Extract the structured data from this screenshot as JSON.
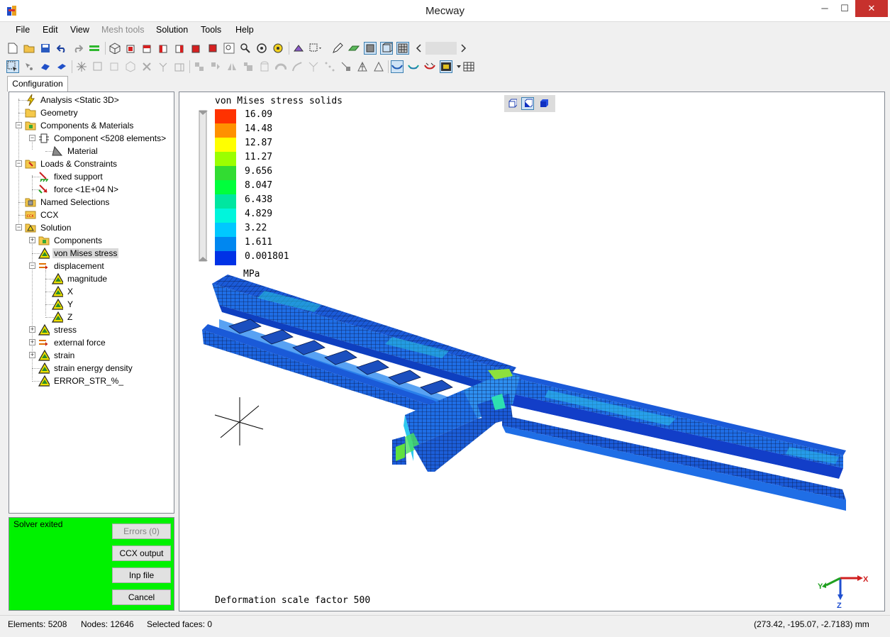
{
  "window": {
    "title": "Mecway",
    "minimize": "─",
    "maximize": "☐",
    "close": "✕"
  },
  "menu": [
    {
      "label": "File",
      "enabled": true
    },
    {
      "label": "Edit",
      "enabled": true
    },
    {
      "label": "View",
      "enabled": true
    },
    {
      "label": "Mesh tools",
      "enabled": false
    },
    {
      "label": "Solution",
      "enabled": true
    },
    {
      "label": "Tools",
      "enabled": true
    },
    {
      "label": "Help",
      "enabled": true
    }
  ],
  "tabs": {
    "configuration": "Configuration"
  },
  "tree": {
    "analysis": "Analysis <Static 3D>",
    "geometry": "Geometry",
    "components_materials": "Components & Materials",
    "component": "Component <5208 elements>",
    "material": "Material",
    "loads_constraints": "Loads & Constraints",
    "fixed_support": "fixed support",
    "force": "force <1E+04 N>",
    "named_selections": "Named Selections",
    "ccx": "CCX",
    "solution": "Solution",
    "sol_components": "Components",
    "von_mises": "von Mises stress",
    "displacement": "displacement",
    "magnitude": "magnitude",
    "x": "X",
    "y": "Y",
    "z": "Z",
    "stress": "stress",
    "external_force": "external force",
    "strain": "strain",
    "strain_energy": "strain energy density",
    "error_str": "ERROR_STR_%_",
    "selected_item": "von Mises stress"
  },
  "solver": {
    "status": "Solver exited",
    "status_color": "#00f200",
    "errors_label": "Errors (0)",
    "ccx_output_label": "CCX output",
    "inp_file_label": "Inp file",
    "cancel_label": "Cancel"
  },
  "viewport": {
    "result_title": "von Mises stress solids",
    "units": "MPa",
    "deformation": "Deformation scale factor 500",
    "legend": {
      "values": [
        "16.09",
        "14.48",
        "12.87",
        "11.27",
        "9.656",
        "8.047",
        "6.438",
        "4.829",
        "3.22",
        "1.611",
        "0.001801"
      ],
      "colors": [
        "#ff3200",
        "#ff9100",
        "#ffff00",
        "#9bff00",
        "#32dc32",
        "#00ff3c",
        "#00e6a0",
        "#00f5dc",
        "#00c8ff",
        "#0087f0",
        "#0032e6"
      ]
    },
    "triad": {
      "x": "X",
      "y": "Y",
      "z": "Z"
    }
  },
  "statusbar": {
    "elements": "Elements: 5208",
    "nodes": "Nodes: 12646",
    "selected_faces": "Selected faces: 0",
    "coordinates": "(273.42, -195.07, -2.7183) mm"
  }
}
